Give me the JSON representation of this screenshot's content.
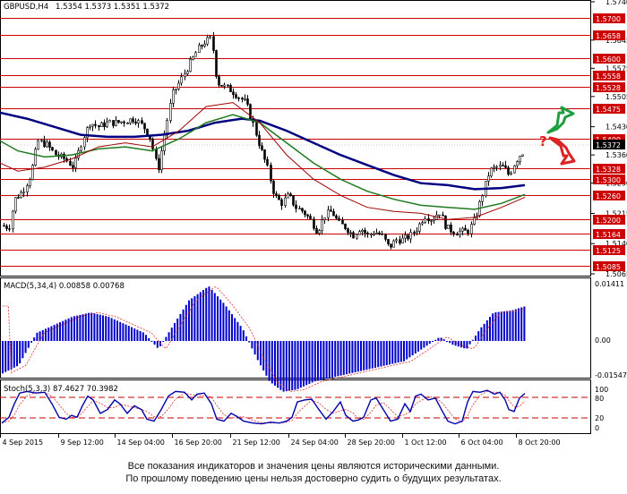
{
  "header": {
    "symbol": "GBPUSD,H4",
    "quotes": "1.5354 1.5373 1.5351 1.5372",
    "macd": "MACD(5,34,4) 0.00858 0.00768",
    "stoch": "Stoch(5,3,3) 87.4627 70.3982"
  },
  "price_axis": {
    "ticks": [
      "1.5740",
      "1.5645",
      "1.5575",
      "1.5505",
      "1.5430",
      "1.5360",
      "1.5290",
      "1.5215",
      "1.5140",
      "1.5065"
    ],
    "levels": [
      "1.5700",
      "1.5658",
      "1.5600",
      "1.5558",
      "1.5528",
      "1.5475",
      "1.5400",
      "1.5328",
      "1.5300",
      "1.5260",
      "1.5200",
      "1.5164",
      "1.5125",
      "1.5085"
    ],
    "current": "1.5372"
  },
  "macd_axis": [
    "0.01411",
    "0.00",
    "-0.01547"
  ],
  "stoch_axis": [
    "100",
    "80",
    "20",
    "0"
  ],
  "time_axis": [
    "4 Sep 2015",
    "9 Sep 12:00",
    "14 Sep 04:00",
    "16 Sep 20:00",
    "21 Sep 12:00",
    "24 Sep 04:00",
    "28 Sep 20:00",
    "1 Oct 12:00",
    "6 Oct 04:00",
    "8 Oct 20:00"
  ],
  "question_mark": "?",
  "colors": {
    "level_line": "#cc0000",
    "ma_slow": "#000080",
    "ma_mid": "#1e7a1e",
    "ma_fast": "#a00000",
    "macd_bar": "#0000cc",
    "stoch_main": "#0000aa",
    "arrow_up": "#1e9e3e",
    "arrow_down": "#dd2222"
  },
  "disclaimer": {
    "line1": "Все показания индикаторов и значения цены являются историческими данными.",
    "line2": "По прошлому поведению цены нельзя достоверно судить о будущих результатах."
  }
}
